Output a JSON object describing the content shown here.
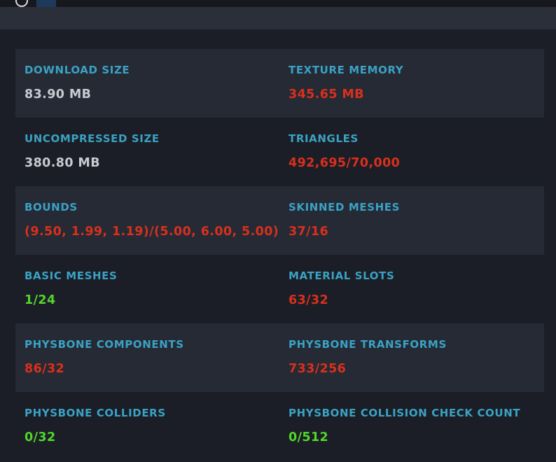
{
  "colors": {
    "label": "#3aa2c4",
    "neutral": "#c8cbd1",
    "bad": "#d9301c",
    "good": "#52d62a",
    "row_alt": "#252a35",
    "background": "#1b1e26"
  },
  "header": {
    "icon": "circle-icon"
  },
  "stats": [
    {
      "left": {
        "label": "DOWNLOAD SIZE",
        "value": "83.90 MB",
        "status": "neutral"
      },
      "right": {
        "label": "TEXTURE MEMORY",
        "value": "345.65 MB",
        "status": "bad"
      }
    },
    {
      "left": {
        "label": "UNCOMPRESSED SIZE",
        "value": "380.80 MB",
        "status": "neutral"
      },
      "right": {
        "label": "TRIANGLES",
        "value": "492,695/70,000",
        "status": "bad"
      }
    },
    {
      "left": {
        "label": "BOUNDS",
        "value": "(9.50, 1.99, 1.19)/(5.00, 6.00, 5.00)",
        "status": "bad"
      },
      "right": {
        "label": "SKINNED MESHES",
        "value": "37/16",
        "status": "bad"
      }
    },
    {
      "left": {
        "label": "BASIC MESHES",
        "value": "1/24",
        "status": "good"
      },
      "right": {
        "label": "MATERIAL SLOTS",
        "value": "63/32",
        "status": "bad"
      }
    },
    {
      "left": {
        "label": "PHYSBONE COMPONENTS",
        "value": "86/32",
        "status": "bad"
      },
      "right": {
        "label": "PHYSBONE TRANSFORMS",
        "value": "733/256",
        "status": "bad"
      }
    },
    {
      "left": {
        "label": "PHYSBONE COLLIDERS",
        "value": "0/32",
        "status": "good"
      },
      "right": {
        "label": "PHYSBONE COLLISION CHECK COUNT",
        "value": "0/512",
        "status": "good"
      }
    }
  ]
}
